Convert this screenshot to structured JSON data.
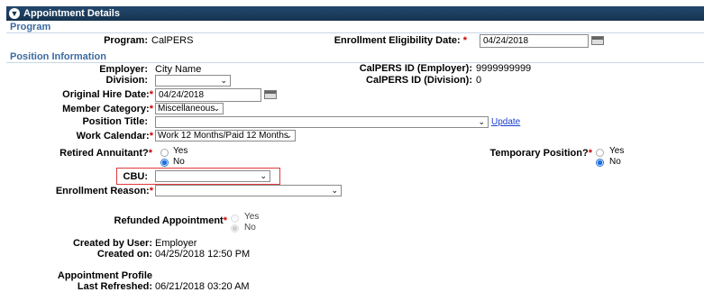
{
  "panel": {
    "title": "Appointment Details"
  },
  "program_section": {
    "heading": "Program",
    "program_label": "Program:",
    "program_value": "CalPERS",
    "eligibility_label": "Enrollment Eligibility Date:",
    "eligibility_required": "*",
    "eligibility_value": "04/24/2018"
  },
  "position_section": {
    "heading": "Position Information",
    "employer_label": "Employer:",
    "employer_value": "City Name",
    "calpers_employer_label": "CalPERS ID (Employer):",
    "calpers_employer_value": "9999999999",
    "division_label": "Division:",
    "division_value": "",
    "calpers_division_label": "CalPERS ID (Division):",
    "calpers_division_value": "0",
    "hire_date_label": "Original Hire Date:",
    "hire_date_required": "*",
    "hire_date_value": "04/24/2018",
    "member_category_label": "Member Category:",
    "member_category_required": "*",
    "member_category_value": "Miscellaneous",
    "position_title_label": "Position Title:",
    "position_title_value": "",
    "update_link": "Update",
    "work_calendar_label": "Work Calendar:",
    "work_calendar_required": "*",
    "work_calendar_value": "Work 12 Months/Paid 12 Months",
    "retired_label": "Retired Annuitant?",
    "retired_required": "*",
    "retired_yes": "Yes",
    "retired_no": "No",
    "temporary_label": "Temporary Position?",
    "temporary_required": "*",
    "temporary_yes": "Yes",
    "temporary_no": "No",
    "cbu_label": "CBU:",
    "cbu_value": "",
    "enrollment_reason_label": "Enrollment Reason:",
    "enrollment_reason_required": "*",
    "enrollment_reason_value": "",
    "refunded_label": "Refunded Appointment",
    "refunded_required": "*",
    "refunded_yes": "Yes",
    "refunded_no": "No",
    "created_by_label": "Created by User:",
    "created_by_value": "Employer",
    "created_on_label": "Created on:",
    "created_on_value": "04/25/2018 12:50 PM",
    "profile_label": "Appointment Profile",
    "refreshed_label": "Last Refreshed:",
    "refreshed_value": "06/21/2018 03:20 AM"
  },
  "selected": {
    "retired": "No",
    "temporary": "No",
    "refunded": "No"
  },
  "colors": {
    "header": "#1c3d5e",
    "section": "#3d6aa0",
    "required": "#cc0000",
    "highlight": "#e03a3a",
    "link": "#1a3fd1"
  },
  "icons": {
    "collapse": "chevron-down-circle-icon",
    "calendar": "calendar-icon",
    "dropdown": "chevron-down-icon"
  }
}
